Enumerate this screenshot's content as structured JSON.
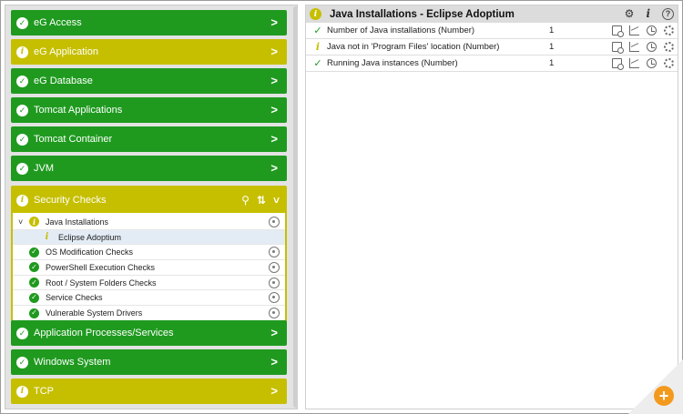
{
  "left_panel": {
    "layers_top": [
      {
        "label": "eG Access",
        "status": "ok"
      },
      {
        "label": "eG Application",
        "status": "warn"
      },
      {
        "label": "eG Database",
        "status": "ok"
      },
      {
        "label": "Tomcat Applications",
        "status": "ok"
      },
      {
        "label": "Tomcat Container",
        "status": "ok"
      },
      {
        "label": "JVM",
        "status": "ok"
      }
    ],
    "expanded_layer": {
      "label": "Security Checks",
      "status": "warn",
      "tests": [
        {
          "label": "Java Installations",
          "status": "warn",
          "expanded": true
        },
        {
          "label": "Eclipse Adoptium",
          "status": "warn",
          "selected": true
        },
        {
          "label": "OS Modification Checks",
          "status": "ok"
        },
        {
          "label": "PowerShell Execution Checks",
          "status": "ok"
        },
        {
          "label": "Root / System Folders Checks",
          "status": "ok"
        },
        {
          "label": "Service Checks",
          "status": "ok"
        },
        {
          "label": "Vulnerable System Drivers",
          "status": "ok"
        }
      ]
    },
    "layers_bottom": [
      {
        "label": "Application Processes/Services",
        "status": "ok"
      },
      {
        "label": "Windows System",
        "status": "ok"
      },
      {
        "label": "TCP",
        "status": "warn"
      }
    ],
    "icons": {
      "ok": "✓",
      "warn": "i",
      "chevron": ">",
      "caret": "⌄"
    }
  },
  "right_panel": {
    "title": "Java Installations - Eclipse Adoptium",
    "status": "warn",
    "info_label": "i",
    "help_label": "?",
    "measures": [
      {
        "name": "Number of Java installations (Number)",
        "value": "1",
        "status": "ok"
      },
      {
        "name": "Java not in 'Program Files' location (Number)",
        "value": "1",
        "status": "warn"
      },
      {
        "name": "Running Java instances (Number)",
        "value": "1",
        "status": "ok"
      }
    ]
  },
  "fab": {
    "label": "+"
  },
  "colors": {
    "ok": "#1f9a1f",
    "warn": "#c6bf00",
    "fab": "#f39a1e"
  }
}
